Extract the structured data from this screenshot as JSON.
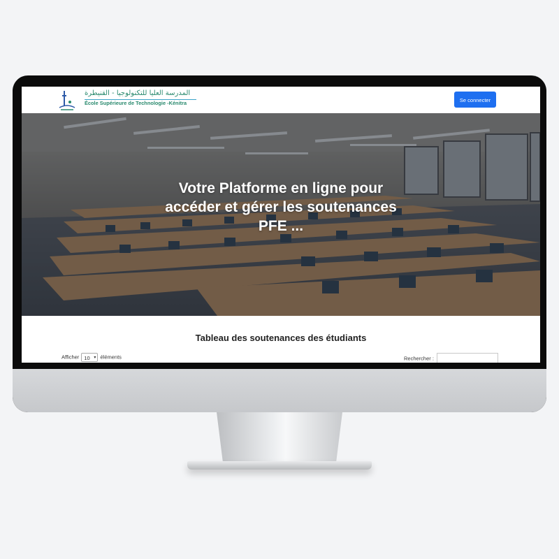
{
  "navbar": {
    "logo_arabic": "المدرسة العليا للتكنولوجيا - القنيطرة",
    "logo_french": "École Supérieure de Technologie -Kénitra",
    "login_label": "Se connecter"
  },
  "hero": {
    "title": "Votre Platforme en ligne pour accéder et gérer les soutenances PFE ..."
  },
  "table_section": {
    "title": "Tableau des soutenances des étudiants",
    "show_prefix": "Afficher",
    "page_length": "10",
    "show_suffix": "éléments",
    "search_label": "Rechercher :",
    "search_value": ""
  },
  "colors": {
    "accent": "#1e6ff0",
    "logo_green": "#2a8a6e",
    "logo_blue": "#3aa3c9"
  }
}
